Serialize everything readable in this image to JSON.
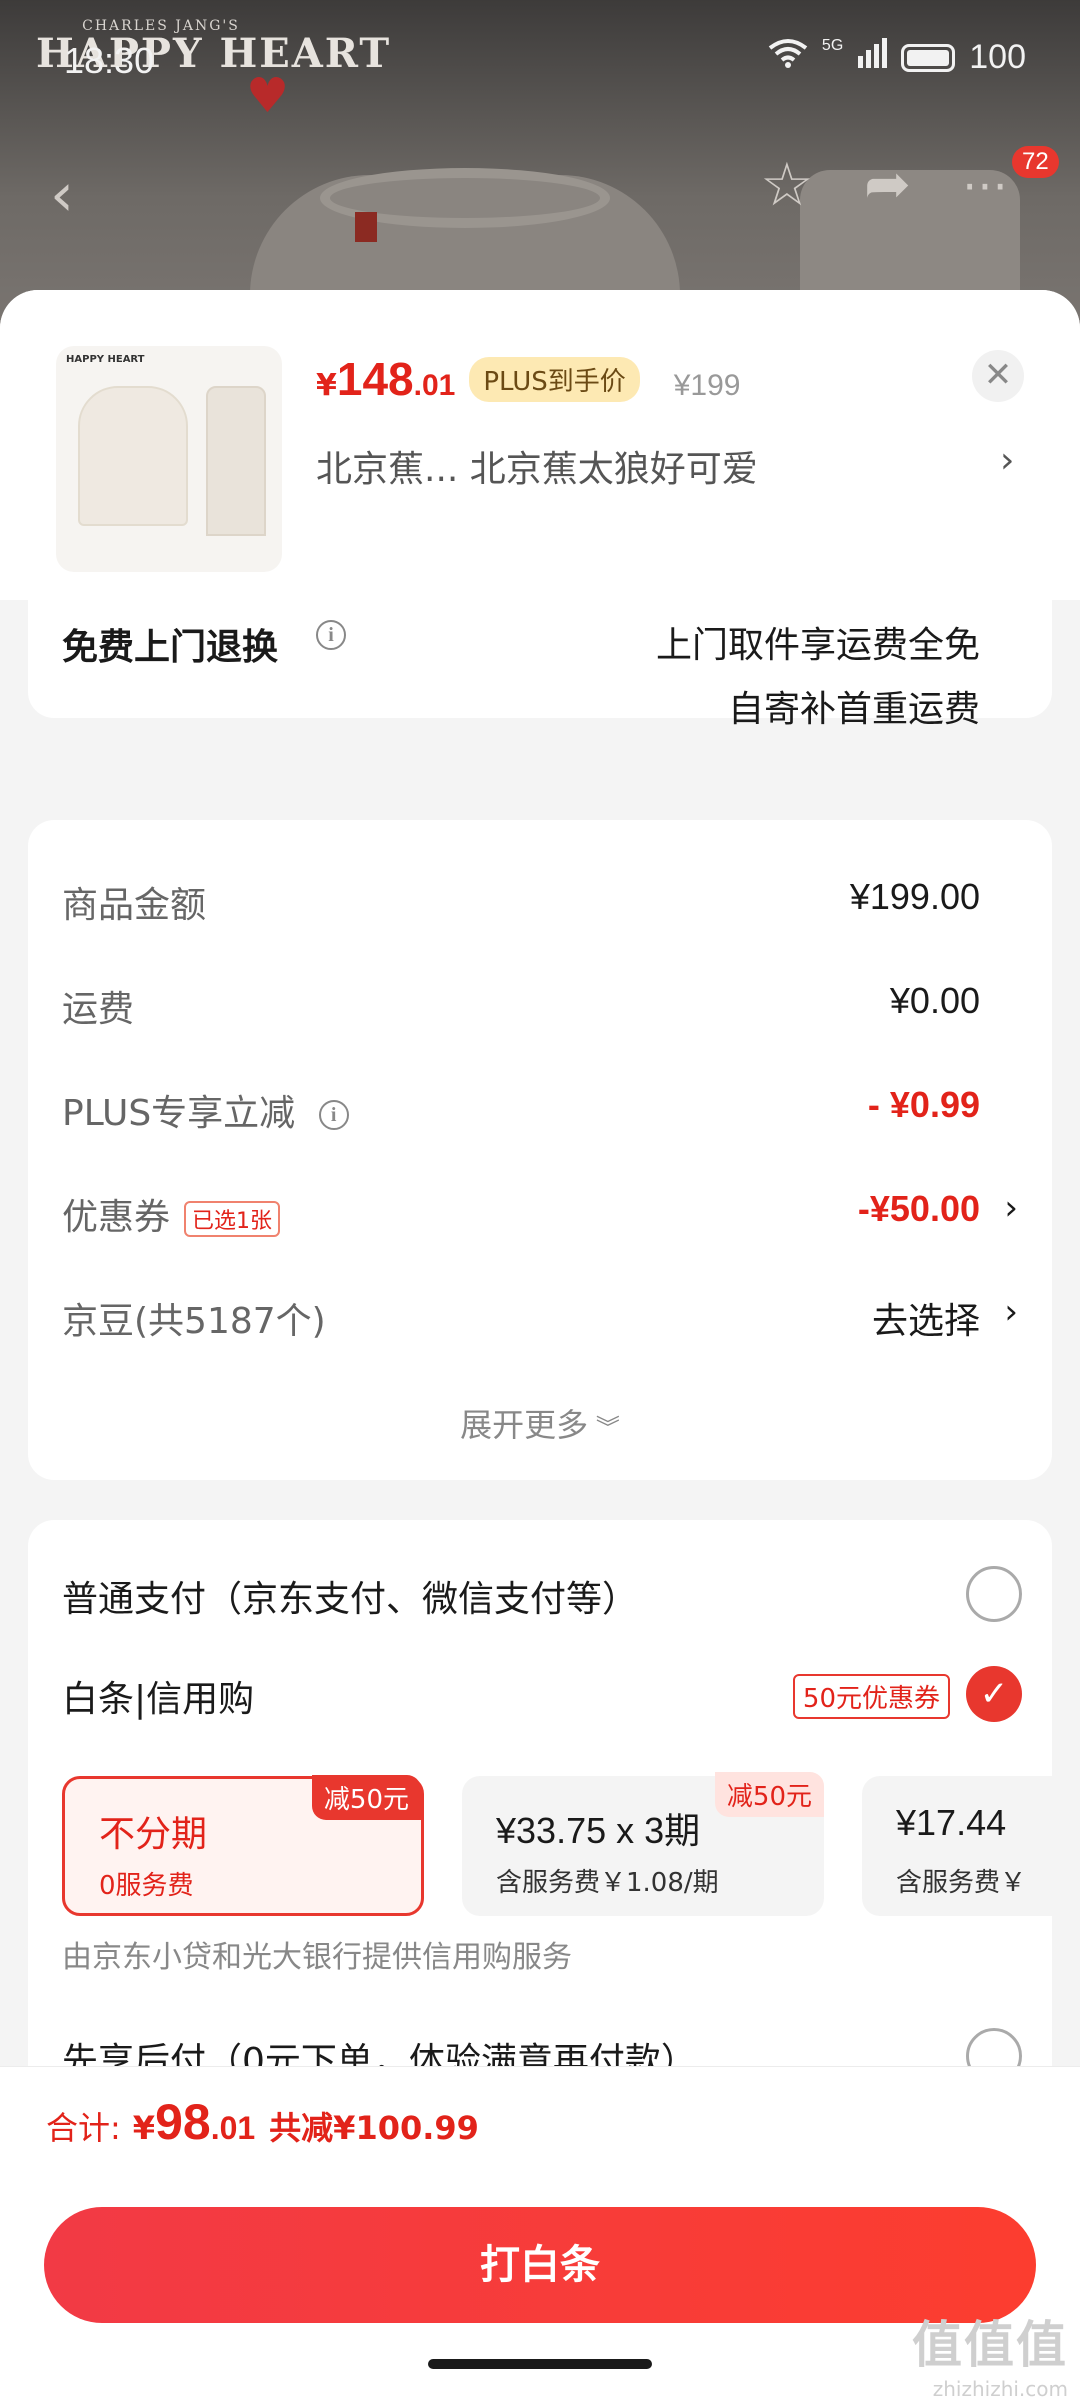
{
  "status_bar": {
    "time": "18:30",
    "network": "5G",
    "battery": "100"
  },
  "background": {
    "brand_top": "CHARLES JANG'S",
    "brand_main": "HAPPY HEART",
    "cart_badge": "72"
  },
  "product": {
    "price_symbol": "¥",
    "price_int": "148",
    "price_dec": ".01",
    "plus_tag": "PLUS到手价",
    "original_price": "¥199",
    "name": "北京蕉...  北京蕉太狼好可爱"
  },
  "return_service": {
    "title": "免费上门退换",
    "line1": "上门取件享运费全免",
    "line2": "自寄补首重运费"
  },
  "cost": {
    "rows": [
      {
        "label": "商品金额",
        "value": "¥199.00"
      },
      {
        "label": "运费",
        "value": "¥0.00"
      },
      {
        "label": "PLUS专享立减",
        "value": "- ¥0.99"
      },
      {
        "label": "优惠券",
        "tag": "已选1张",
        "value": "-¥50.00"
      },
      {
        "label": "京豆(共5187个)",
        "value": "去选择"
      }
    ],
    "expand": "展开更多"
  },
  "payment": {
    "normal_label": "普通支付（京东支付、微信支付等）",
    "baitiao_label": "白条|信用购",
    "baitiao_coupon": "50元优惠券",
    "plans": [
      {
        "title": "不分期",
        "sub": "0服务费",
        "badge": "减50元",
        "selected": true
      },
      {
        "title": "¥33.75 x 3期",
        "sub": "含服务费￥1.08/期",
        "badge": "减50元",
        "selected": false
      },
      {
        "title": "¥17.44",
        "sub": "含服务费￥",
        "badge": "",
        "selected": false
      }
    ],
    "provider": "由京东小贷和光大银行提供信用购服务",
    "later_label": "先享后付（0元下单，体验满意再付款）"
  },
  "footer": {
    "total_label": "合计:",
    "total_symbol": "¥",
    "total_int": "98",
    "total_dec": ".01",
    "total_saved": "共减¥100.99",
    "button": "打白条"
  },
  "watermark": {
    "main": "值值值",
    "sub": "zhizhizhi.com"
  }
}
